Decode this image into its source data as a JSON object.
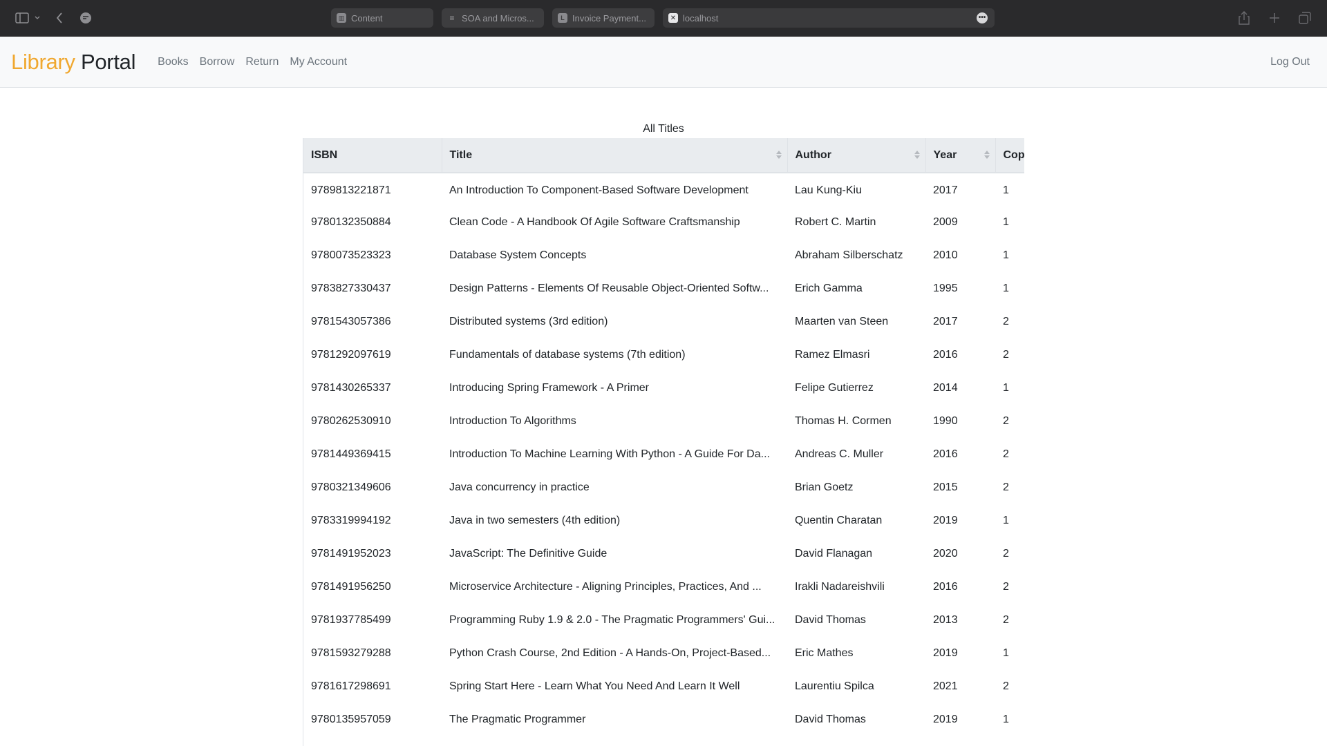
{
  "browser": {
    "tabs": [
      {
        "title": "Content",
        "favicon": "chart-favicon"
      },
      {
        "title": "SOA and Micros...",
        "favicon": "doc-favicon"
      },
      {
        "title": "Invoice Payment...",
        "favicon": "L"
      },
      {
        "title": "localhost",
        "favicon": "close-favicon"
      }
    ]
  },
  "navbar": {
    "brand_part1": "Library",
    "brand_part2": "Portal",
    "links": [
      "Books",
      "Borrow",
      "Return",
      "My Account"
    ],
    "logout": "Log Out",
    "brand_color": "#f0a830"
  },
  "table": {
    "caption": "All Titles",
    "columns": [
      "ISBN",
      "Title",
      "Author",
      "Year",
      "Copies"
    ],
    "rows": [
      [
        "9789813221871",
        "An Introduction To Component-Based Software Development",
        "Lau Kung-Kiu",
        "2017",
        "1"
      ],
      [
        "9780132350884",
        "Clean Code - A Handbook Of Agile Software Craftsmanship",
        "Robert C. Martin",
        "2009",
        "1"
      ],
      [
        "9780073523323",
        "Database System Concepts",
        "Abraham Silberschatz",
        "2010",
        "1"
      ],
      [
        "9783827330437",
        "Design Patterns - Elements Of Reusable Object-Oriented Softw...",
        "Erich Gamma",
        "1995",
        "1"
      ],
      [
        "9781543057386",
        "Distributed systems (3rd edition)",
        "Maarten van Steen",
        "2017",
        "2"
      ],
      [
        "9781292097619",
        "Fundamentals of database systems (7th edition)",
        "Ramez Elmasri",
        "2016",
        "2"
      ],
      [
        "9781430265337",
        "Introducing Spring Framework - A Primer",
        "Felipe Gutierrez",
        "2014",
        "1"
      ],
      [
        "9780262530910",
        "Introduction To Algorithms",
        "Thomas H. Cormen",
        "1990",
        "2"
      ],
      [
        "9781449369415",
        "Introduction To Machine Learning With Python - A Guide For Da...",
        "Andreas C. Muller",
        "2016",
        "2"
      ],
      [
        "9780321349606",
        "Java concurrency in practice",
        "Brian Goetz",
        "2015",
        "2"
      ],
      [
        "9783319994192",
        "Java in two semesters (4th edition)",
        "Quentin Charatan",
        "2019",
        "1"
      ],
      [
        "9781491952023",
        "JavaScript: The Definitive Guide",
        "David Flanagan",
        "2020",
        "2"
      ],
      [
        "9781491956250",
        "Microservice Architecture - Aligning Principles, Practices, And ...",
        "Irakli Nadareishvili",
        "2016",
        "2"
      ],
      [
        "9781937785499",
        "Programming Ruby 1.9 & 2.0 - The Pragmatic Programmers' Gui...",
        "David Thomas",
        "2013",
        "2"
      ],
      [
        "9781593279288",
        "Python Crash Course, 2nd Edition - A Hands-On, Project-Based...",
        "Eric Mathes",
        "2019",
        "1"
      ],
      [
        "9781617298691",
        "Spring Start Here - Learn What You Need And Learn It Well",
        "Laurentiu Spilca",
        "2021",
        "2"
      ],
      [
        "9780135957059",
        "The Pragmatic Programmer",
        "David Thomas",
        "2019",
        "1"
      ]
    ]
  }
}
